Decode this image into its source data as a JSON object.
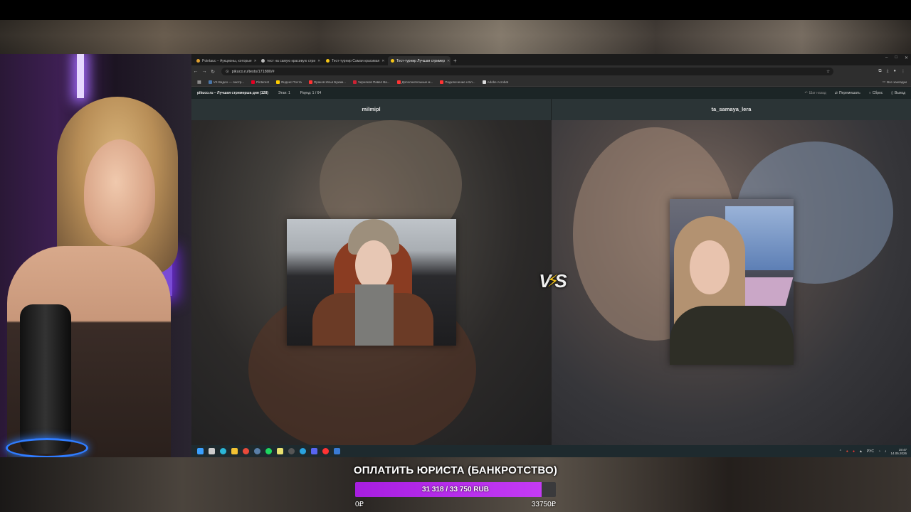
{
  "browser": {
    "tabs": [
      {
        "label": "Pointauc – Аукционы, которые",
        "icon": "pointauc-icon",
        "color": "#e0a030",
        "active": false
      },
      {
        "label": "тест на самую красивую стри",
        "icon": "globe-icon",
        "color": "#bbbbbb",
        "active": false
      },
      {
        "label": "Тест-турнир Самая красивая",
        "icon": "pikuco-icon",
        "color": "#f5c518",
        "active": false
      },
      {
        "label": "Тест-турнир Лучшая стример",
        "icon": "pikuco-icon",
        "color": "#f5c518",
        "active": true
      }
    ],
    "new_tab": "+",
    "window_controls": [
      "–",
      "□",
      "✕"
    ],
    "url": "pikuco.ru/tests/171880/#",
    "bookmarks": [
      {
        "label": "VK Видео — смотр...",
        "color": "#4a76a8"
      },
      {
        "label": "Pinterest",
        "color": "#e60023"
      },
      {
        "label": "Яндекс Почта",
        "color": "#ffcc00"
      },
      {
        "label": "Ораков Илья Букам...",
        "color": "#ff3333"
      },
      {
        "label": "Черняков Павел Ва...",
        "color": "#cc2233"
      },
      {
        "label": "Дополнительные м...",
        "color": "#ff3333"
      },
      {
        "label": "Подключение к Бл...",
        "color": "#ff3333"
      },
      {
        "label": "Adobe Acrobat",
        "color": "#dddddd"
      }
    ],
    "bookmarks_all": "Все закладки"
  },
  "site": {
    "title": "pikuco.ru – Лучшая стримерша дня (128)",
    "stage": "Этап: 1",
    "round": "Раунд: 1 / 64",
    "actions": {
      "back": "Шаг назад",
      "shuffle": "Перемешать",
      "reset": "Сброс",
      "exit": "Выход"
    }
  },
  "contest": {
    "left_name": "milmipl",
    "right_name": "ta_samaya_lera",
    "vs_left": "V",
    "vs_right": "S"
  },
  "taskbar": {
    "icons": [
      {
        "name": "windows-start-icon",
        "color": "#3aa0ff"
      },
      {
        "name": "task-view-icon",
        "color": "#cccccc"
      },
      {
        "name": "edge-icon",
        "color": "#2bb7d8"
      },
      {
        "name": "file-explorer-icon",
        "color": "#f2c233"
      },
      {
        "name": "chrome-icon",
        "color": "#e84a3a"
      },
      {
        "name": "steam-icon",
        "color": "#5a7fa8"
      },
      {
        "name": "spotify-icon",
        "color": "#1ed760"
      },
      {
        "name": "app-icon",
        "color": "#e8e070"
      },
      {
        "name": "obs-icon",
        "color": "#555555"
      },
      {
        "name": "telegram-icon",
        "color": "#2aa3e0"
      },
      {
        "name": "discord-icon",
        "color": "#5865f2"
      },
      {
        "name": "yandex-icon",
        "color": "#ff3333"
      },
      {
        "name": "app2-icon",
        "color": "#3a7bd5"
      }
    ],
    "lang": "РУС",
    "time": "19:47",
    "date": "14.05.2026"
  },
  "goal": {
    "title": "ОПЛАТИТЬ ЮРИСТА (БАНКРОТСТВО)",
    "progress_text": "31 318 / 33 750 RUB",
    "current": 31318,
    "target": 33750,
    "min_label": "0₽",
    "max_label": "33750₽",
    "color": "#b52be8"
  }
}
